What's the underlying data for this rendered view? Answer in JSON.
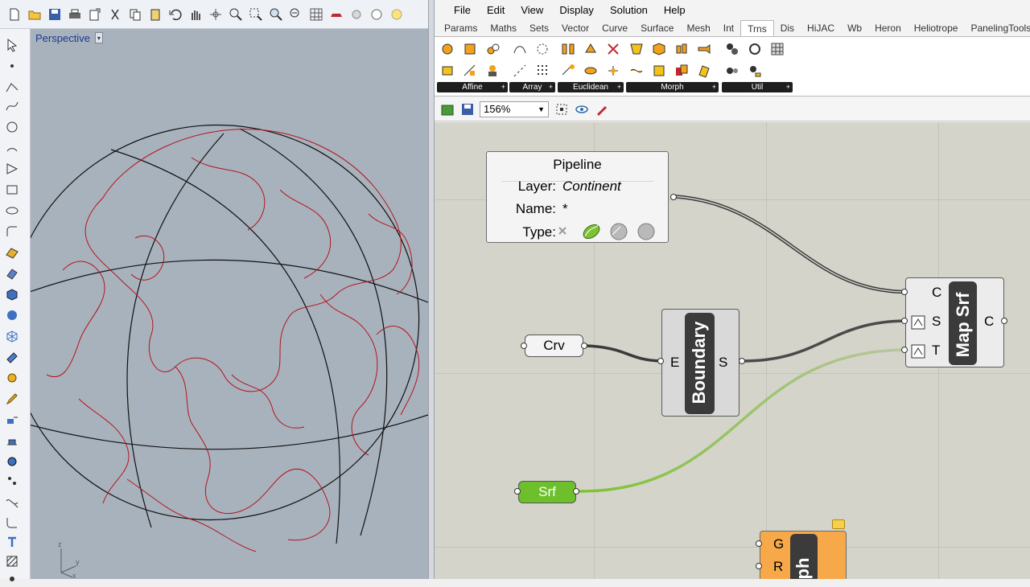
{
  "rhino": {
    "viewport_label": "Perspective",
    "viewport_dropdown_icon": "chevron-down-icon",
    "axis_labels": {
      "x": "x",
      "y": "y",
      "z": "z"
    }
  },
  "gh": {
    "menu": [
      "File",
      "Edit",
      "View",
      "Display",
      "Solution",
      "Help"
    ],
    "tabs": [
      "Params",
      "Maths",
      "Sets",
      "Vector",
      "Curve",
      "Surface",
      "Mesh",
      "Int",
      "Trns",
      "Dis",
      "HiJAC",
      "Wb",
      "Heron",
      "Heliotrope",
      "PanelingTools"
    ],
    "active_tab": "Trns",
    "ribbon_groups": [
      "Affine",
      "Array",
      "Euclidean",
      "Morph",
      "Util"
    ],
    "zoom": "156%",
    "pipeline": {
      "title": "Pipeline",
      "layer_label": "Layer:",
      "layer_value": "Continent",
      "name_label": "Name:",
      "name_value": "*",
      "type_label": "Type:"
    },
    "crv_label": "Crv",
    "srf_label": "Srf",
    "boundary": {
      "title": "Boundary",
      "input": "E",
      "output": "S"
    },
    "mapsrf": {
      "title": "Map Srf",
      "inputs": [
        "C",
        "S",
        "T"
      ],
      "output": "C"
    },
    "morph": {
      "title": "ph",
      "inputs": [
        "G",
        "R"
      ]
    }
  },
  "colors": {
    "viewport_bg": "#a8b2bd",
    "continent_red": "#b4141c",
    "srf_green": "#6dc02c",
    "morph_orange": "#f7a94a",
    "canvas_bg": "#d5d4cb"
  }
}
